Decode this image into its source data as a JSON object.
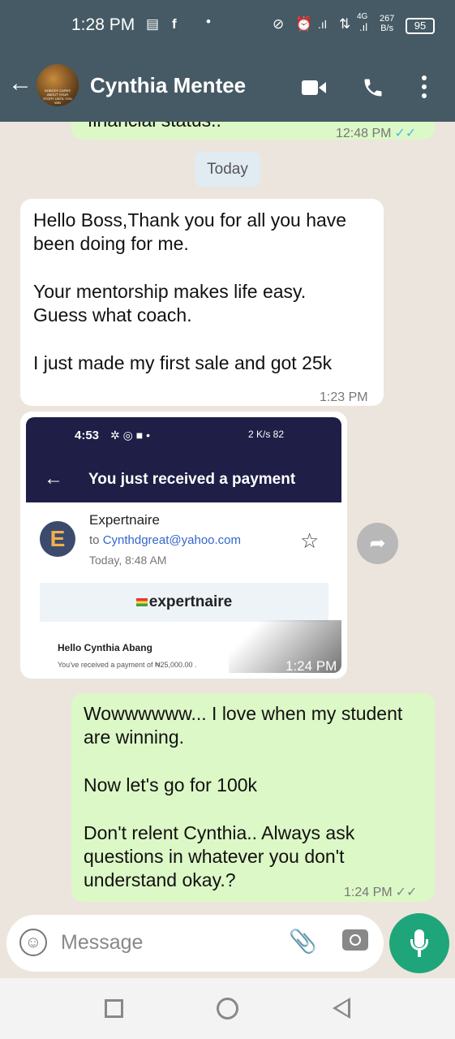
{
  "status_bar": {
    "time": "1:28 PM",
    "net_speed_value": "267",
    "net_speed_unit": "B/s",
    "network_type": "4G",
    "battery": "95"
  },
  "header": {
    "contact_name": "Cynthia Mentee",
    "avatar_caption": "NOBODY CARES ABOUT YOUR STORY UNTIL YOU WIN"
  },
  "chat": {
    "prev_message_partial": "financial status..",
    "prev_message_time": "12:48 PM",
    "date_chip": "Today",
    "messages": [
      {
        "direction": "incoming",
        "paragraphs": [
          "Hello Boss,Thank you for all you have been doing for me.",
          "Your mentorship makes life easy. Guess what coach.",
          "I just made my first sale and got 25k"
        ],
        "time": "1:23 PM"
      },
      {
        "direction": "incoming",
        "type": "image",
        "time": "1:24 PM",
        "screenshot": {
          "phone_time": "4:53",
          "phone_status": "2 K/s 82",
          "title": "You just received a payment",
          "sender_initial": "E",
          "sender": "Expertnaire",
          "to_prefix": "to",
          "to_email": "Cynthdgreat@yahoo.com",
          "received_at": "Today, 8:48 AM",
          "brand": "expertnaire",
          "greeting": "Hello Cynthia Abang",
          "payment_line": "You've received a payment of ₦25,000.00 ."
        }
      },
      {
        "direction": "outgoing",
        "paragraphs": [
          "Wowwwwww... I love when my student are winning.",
          "Now let's go for 100k",
          "Don't relent Cynthia.. Always ask questions in whatever you don't understand okay.?"
        ],
        "time": "1:24 PM"
      }
    ]
  },
  "input": {
    "placeholder": "Message"
  }
}
